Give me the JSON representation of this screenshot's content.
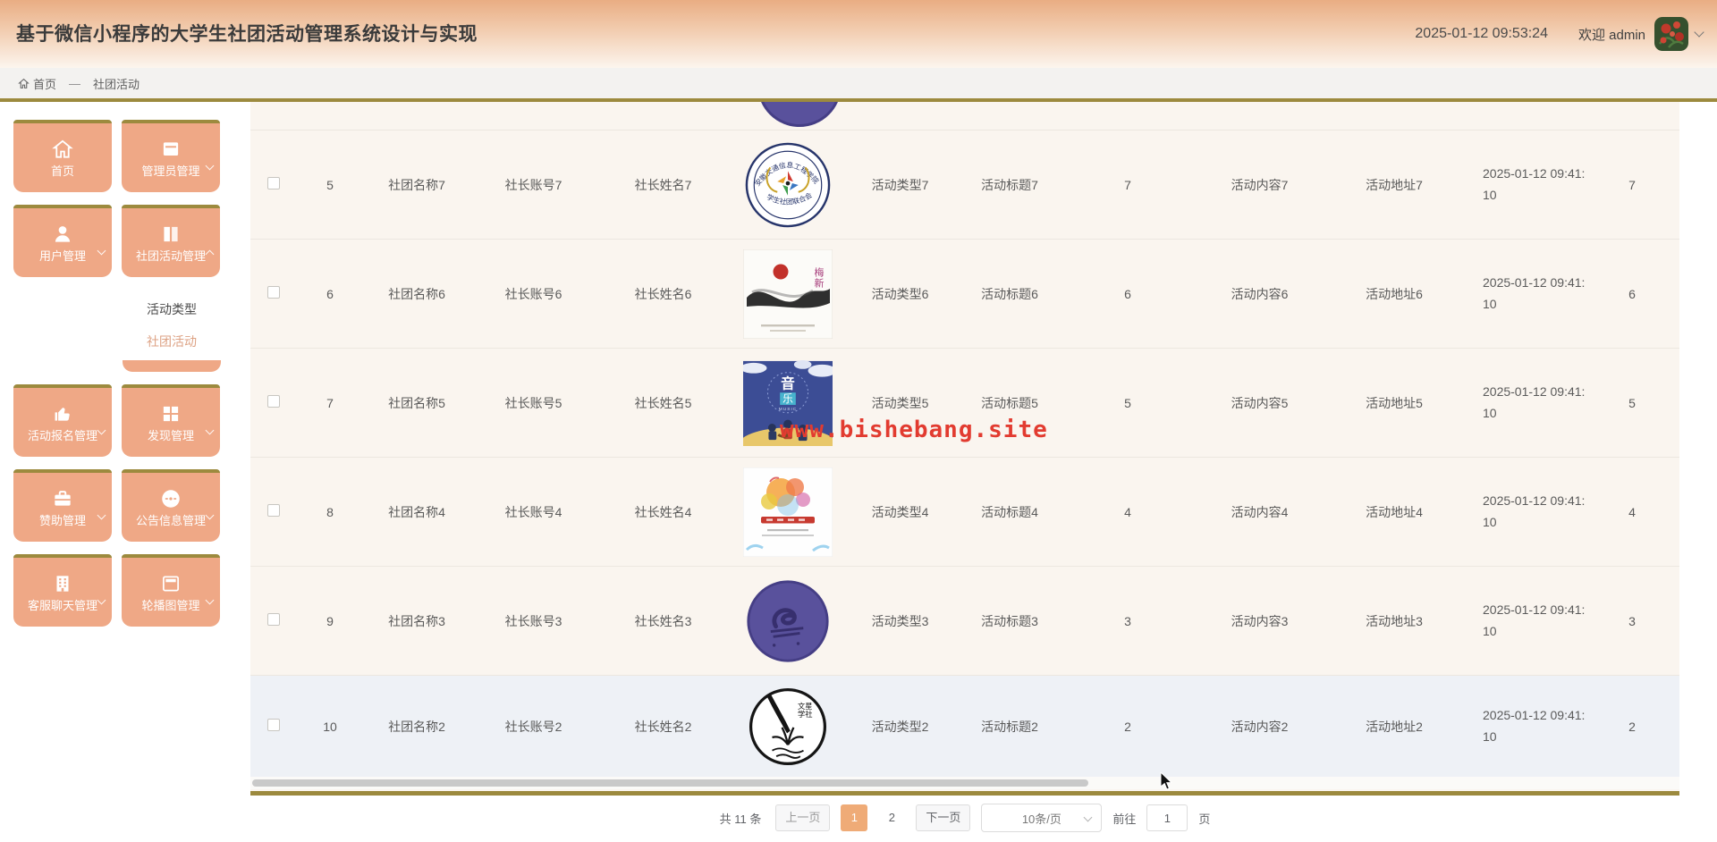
{
  "header": {
    "title": "基于微信小程序的大学生社团活动管理系统设计与实现",
    "datetime": "2025-01-12 09:53:24",
    "welcome_text": "欢迎 admin"
  },
  "breadcrumb": {
    "home_label": "首页",
    "separator": "—",
    "current": "社团活动"
  },
  "sidebar": {
    "buttons": [
      {
        "key": "home",
        "label": "首页",
        "icon": "home-icon",
        "chevron": ""
      },
      {
        "key": "admin-management",
        "label": "管理员管理",
        "icon": "admin-panel-icon",
        "chevron": "down"
      },
      {
        "key": "user-management",
        "label": "用户管理",
        "icon": "user-icon",
        "chevron": "down"
      },
      {
        "key": "club-activity-management",
        "label": "社团活动管理",
        "icon": "club-activity-icon",
        "chevron": "up"
      },
      {
        "key": "signup-management",
        "label": "活动报名管理",
        "icon": "signup-icon",
        "chevron": "down"
      },
      {
        "key": "discover-management",
        "label": "发现管理",
        "icon": "discover-grid-icon",
        "chevron": "down"
      },
      {
        "key": "sponsor-management",
        "label": "赞助管理",
        "icon": "sponsor-briefcase-icon",
        "chevron": "down"
      },
      {
        "key": "notice-management",
        "label": "公告信息管理",
        "icon": "notice-chat-icon",
        "chevron": "down"
      },
      {
        "key": "service-chat-management",
        "label": "客服聊天管理",
        "icon": "service-building-icon",
        "chevron": "down"
      },
      {
        "key": "carousel-management",
        "label": "轮播图管理",
        "icon": "carousel-image-icon",
        "chevron": "down"
      }
    ],
    "submenu": [
      {
        "key": "activity-type",
        "label": "活动类型",
        "active": false
      },
      {
        "key": "club-activity",
        "label": "社团活动",
        "active": true
      }
    ]
  },
  "watermark_text": "www.bishebang.site",
  "table": {
    "rows": [
      {
        "index": "5",
        "club_name": "社团名称7",
        "leader_account": "社长账号7",
        "leader_name": "社长姓名7",
        "image": "college-emblem-badge",
        "activity_type": "活动类型7",
        "activity_title": "活动标题7",
        "number": "7",
        "activity_content": "活动内容7",
        "activity_address": "活动地址7",
        "datetime_line1": "2025-01-12 09:41:",
        "datetime_line2": "10",
        "number2": "7",
        "shaded": false
      },
      {
        "index": "6",
        "club_name": "社团名称6",
        "leader_account": "社长账号6",
        "leader_name": "社长姓名6",
        "image": "ink-painting-poster",
        "activity_type": "活动类型6",
        "activity_title": "活动标题6",
        "number": "6",
        "activity_content": "活动内容6",
        "activity_address": "活动地址6",
        "datetime_line1": "2025-01-12 09:41:",
        "datetime_line2": "10",
        "number2": "6",
        "shaded": false
      },
      {
        "index": "7",
        "club_name": "社团名称5",
        "leader_account": "社长账号5",
        "leader_name": "社长姓名5",
        "image": "music-poster",
        "activity_type": "活动类型5",
        "activity_title": "活动标题5",
        "number": "5",
        "activity_content": "活动内容5",
        "activity_address": "活动地址5",
        "datetime_line1": "2025-01-12 09:41:",
        "datetime_line2": "10",
        "number2": "5",
        "shaded": false
      },
      {
        "index": "8",
        "club_name": "社团名称4",
        "leader_account": "社长账号4",
        "leader_name": "社长姓名4",
        "image": "watercolor-poster",
        "activity_type": "活动类型4",
        "activity_title": "活动标题4",
        "number": "4",
        "activity_content": "活动内容4",
        "activity_address": "活动地址4",
        "datetime_line1": "2025-01-12 09:41:",
        "datetime_line2": "10",
        "number2": "4",
        "shaded": false
      },
      {
        "index": "9",
        "club_name": "社团名称3",
        "leader_account": "社长账号3",
        "leader_name": "社长姓名3",
        "image": "purple-club-logo",
        "activity_type": "活动类型3",
        "activity_title": "活动标题3",
        "number": "3",
        "activity_content": "活动内容3",
        "activity_address": "活动地址3",
        "datetime_line1": "2025-01-12 09:41:",
        "datetime_line2": "10",
        "number2": "3",
        "shaded": false
      },
      {
        "index": "10",
        "club_name": "社团名称2",
        "leader_account": "社长账号2",
        "leader_name": "社长姓名2",
        "image": "calligraphy-club-logo",
        "activity_type": "活动类型2",
        "activity_title": "活动标题2",
        "number": "2",
        "activity_content": "活动内容2",
        "activity_address": "活动地址2",
        "datetime_line1": "2025-01-12 09:41:",
        "datetime_line2": "10",
        "number2": "2",
        "shaded": true
      }
    ]
  },
  "pagination": {
    "total_text": "共 11 条",
    "prev_label": "上一页",
    "pages": [
      "1",
      "2"
    ],
    "active_page": "1",
    "next_label": "下一页",
    "page_size_label": "10条/页",
    "goto_label": "前往",
    "goto_value": "1",
    "goto_unit": "页"
  },
  "colors": {
    "accent_gold": "#9c8a3e",
    "accent_salmon": "#efa886",
    "active_page_bg": "#efab77",
    "watermark_red": "#e23b30",
    "row_bg": "#faf5ef",
    "shaded_row_bg": "#eef1f6"
  }
}
